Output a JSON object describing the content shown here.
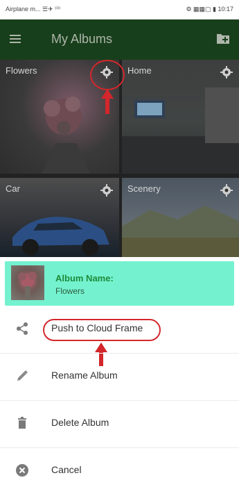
{
  "statusbar": {
    "left_text": "Airplane m... ☰✈ ⁽⁰⁾",
    "right_text": "⚙ ▦▦▢ ▮ 10:17"
  },
  "appbar": {
    "title": "My Albums",
    "menu_icon": "menu-icon",
    "add_icon": "add-folder-icon",
    "bg": "#183f1b",
    "title_color": "#aeb6ab"
  },
  "albums": [
    {
      "label": "Flowers"
    },
    {
      "label": "Home"
    },
    {
      "label": "Car"
    },
    {
      "label": "Scenery"
    }
  ],
  "sheet": {
    "album_name_label": "Album Name:",
    "album_name_value": "Flowers",
    "header_bg": "#74f2cf",
    "items": [
      {
        "label": "Push to Cloud Frame",
        "icon": "share-icon"
      },
      {
        "label": "Rename Album",
        "icon": "pencil-icon"
      },
      {
        "label": "Delete Album",
        "icon": "trash-icon"
      },
      {
        "label": "Cancel",
        "icon": "close-icon"
      }
    ]
  },
  "annotation_color": "#d3272b"
}
